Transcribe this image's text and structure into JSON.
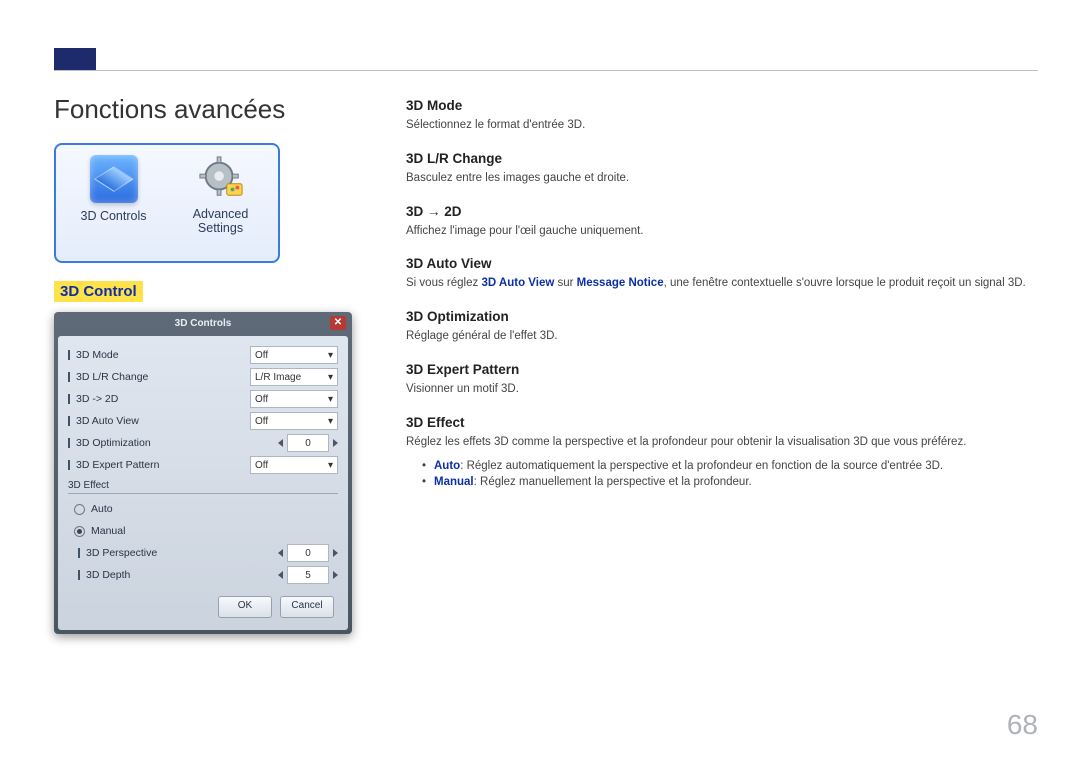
{
  "page_number": "68",
  "title": "Fonctions avancées",
  "icon_tiles": {
    "controls_label": "3D Controls",
    "advanced_label_l1": "Advanced",
    "advanced_label_l2": "Settings"
  },
  "section_label": "3D Control",
  "dialog": {
    "title": "3D Controls",
    "close_glyph": "✕",
    "rows": [
      {
        "label": "3D Mode",
        "value": "Off"
      },
      {
        "label": "3D L/R Change",
        "value": "L/R Image"
      },
      {
        "label": "3D -> 2D",
        "value": "Off"
      },
      {
        "label": "3D Auto View",
        "value": "Off"
      },
      {
        "label": "3D Optimization",
        "spin": "0"
      },
      {
        "label": "3D Expert Pattern",
        "value": "Off"
      }
    ],
    "effect_group": "3D Effect",
    "radio_auto": "Auto",
    "radio_manual": "Manual",
    "sub_rows": [
      {
        "label": "3D Perspective",
        "spin": "0"
      },
      {
        "label": "3D Depth",
        "spin": "5"
      }
    ],
    "ok": "OK",
    "cancel": "Cancel"
  },
  "descriptions": {
    "mode": {
      "h": "3D Mode",
      "p": "Sélectionnez le format d'entrée 3D."
    },
    "lr": {
      "h": "3D L/R Change",
      "p": "Basculez entre les images gauche et droite."
    },
    "to2d": {
      "h": "3D → 2D",
      "p": "Affichez l'image pour l'œil gauche uniquement."
    },
    "autoview": {
      "h": "3D Auto View",
      "pre": "Si vous réglez ",
      "kw1": "3D Auto View",
      "mid": " sur ",
      "kw2": "Message Notice",
      "post": ", une fenêtre contextuelle s'ouvre lorsque le produit reçoit un signal 3D."
    },
    "opt": {
      "h": "3D Optimization",
      "p": "Réglage général de l'effet 3D."
    },
    "expert": {
      "h": "3D Expert Pattern",
      "p": "Visionner un motif 3D."
    },
    "effect": {
      "h": "3D Effect",
      "p": "Réglez les effets 3D comme la perspective et la profondeur pour obtenir la visualisation 3D que vous préférez.",
      "auto_kw": "Auto",
      "auto_txt": ": Réglez automatiquement la perspective et la profondeur en fonction de la source d'entrée 3D.",
      "manual_kw": "Manual",
      "manual_txt": ": Réglez manuellement la perspective et la profondeur."
    }
  }
}
